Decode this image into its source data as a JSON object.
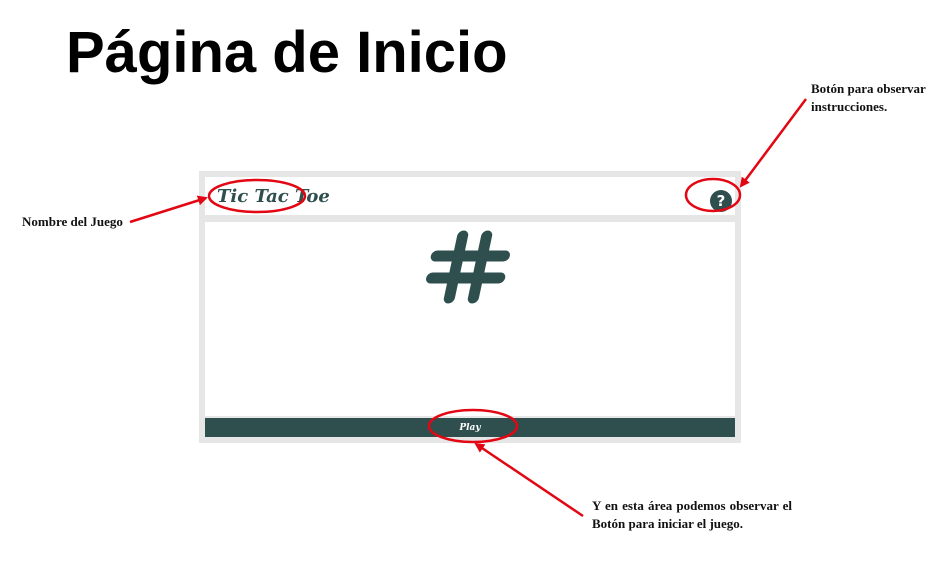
{
  "slide": {
    "title": "Página de Inicio"
  },
  "annotations": {
    "help_button_note": "Botón para observar instrucciones.",
    "game_name_note": "Nombre del Juego",
    "play_note_line1": "Y en esta área podemos observar el",
    "play_note_line2": "Botón para iniciar el juego."
  },
  "app": {
    "game_name": "Tic Tac Toe",
    "help_icon_glyph": "?",
    "play_label": "Play",
    "icons": [
      "hashtag-icon",
      "pointing-hand-icon",
      "question-circle-icon"
    ],
    "colors": {
      "primary": "#2f4f4f",
      "frame": "#e6e6e6",
      "annotation": "#e30613"
    }
  }
}
